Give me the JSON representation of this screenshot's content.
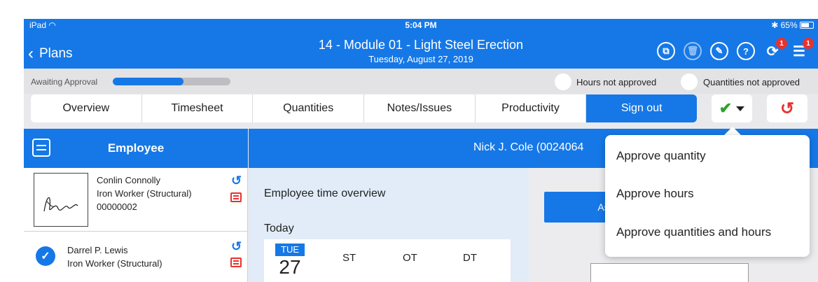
{
  "status_bar": {
    "device": "iPad",
    "time": "5:04 PM",
    "battery": "65%"
  },
  "nav": {
    "back_label": "Plans",
    "title": "14 - Module 01 - Light Steel Erection",
    "subtitle": "Tuesday, August 27, 2019",
    "icons": [
      "copy-icon",
      "trash-icon",
      "edit-icon",
      "help-icon",
      "sync-icon",
      "menu-icon"
    ],
    "sync_badge": "1",
    "menu_badge": "1"
  },
  "approval": {
    "status_label": "Awaiting Approval",
    "progress": 0.6,
    "hours_label": "Hours not approved",
    "quantities_label": "Quantities not approved"
  },
  "tabs": [
    "Overview",
    "Timesheet",
    "Quantities",
    "Notes/Issues",
    "Productivity",
    "Sign out"
  ],
  "active_tab": "Sign out",
  "colors": {
    "accent": "#1678e6",
    "danger": "#e8322f",
    "success": "#2aa32a"
  },
  "employee_panel": {
    "title": "Employee",
    "selected_employee": "Nick J. Cole (0024064",
    "employees": [
      {
        "name": "Conlin Connolly",
        "role": "Iron Worker (Structural)",
        "id": "00000002"
      },
      {
        "name": "Darrel P. Lewis",
        "role": "Iron Worker (Structural)"
      }
    ]
  },
  "overview": {
    "title": "Employee time overview",
    "today_label": "Today",
    "day_of_week": "TUE",
    "day_number": "27",
    "columns": [
      "ST",
      "OT",
      "DT"
    ]
  },
  "right_panel": {
    "button_label": "As em"
  },
  "dropdown": {
    "items": [
      "Approve quantity",
      "Approve hours",
      "Approve quantities and hours"
    ]
  }
}
